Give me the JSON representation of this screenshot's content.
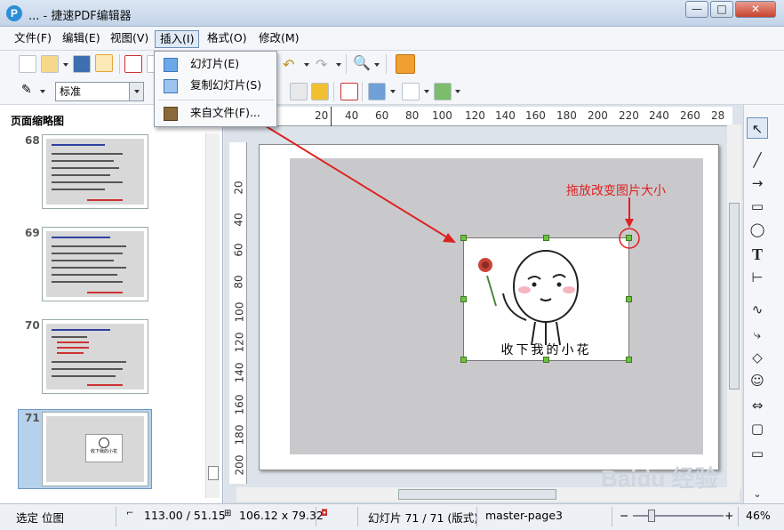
{
  "window": {
    "title": "  ...  - 捷速PDF编辑器",
    "buttons": [
      "—",
      "□",
      "✕"
    ]
  },
  "menu": [
    {
      "label": "文件(F)"
    },
    {
      "label": "编辑(E)"
    },
    {
      "label": "视图(V)"
    },
    {
      "label": "插入(I)"
    },
    {
      "label": "格式(O)"
    },
    {
      "label": "修改(M)"
    }
  ],
  "insert_menu": {
    "items": [
      {
        "label": "幻灯片(E)",
        "icon": "slide-icon"
      },
      {
        "label": "复制幻灯片(S)",
        "icon": "duplicate-slide-icon"
      },
      {
        "label": "来自文件(F)...",
        "icon": "image-file-icon"
      }
    ]
  },
  "toolbar": {
    "style_select": "标准"
  },
  "left_panel": {
    "title": "页面缩略图",
    "thumbnails": [
      {
        "number": "68"
      },
      {
        "number": "69"
      },
      {
        "number": "70"
      },
      {
        "number": "71"
      }
    ],
    "thumb_71_caption": "收下我的小花"
  },
  "ruler": {
    "horizontal": [
      "20",
      "40",
      "60",
      "80",
      "100",
      "120",
      "140",
      "160",
      "180",
      "200",
      "220",
      "240",
      "260",
      "28"
    ],
    "vertical": [
      "20",
      "40",
      "60",
      "80",
      "100",
      "120",
      "140",
      "160",
      "180",
      "200"
    ]
  },
  "canvas": {
    "image_caption": "收下我的小花",
    "annotation": "拖放改变图片大小"
  },
  "status": {
    "selection": "选定 位图",
    "position": "113.00 / 51.15",
    "size": "106.12 x 79.32",
    "slide": "幻灯片 71 / 71 (版式)",
    "master": "master-page3",
    "zoom": "46%"
  },
  "colors": {
    "annotation_red": "#dd2222",
    "handle_green": "#70c040",
    "selected_thumb": "#b7d1ec"
  },
  "watermark": "Baidu 经验"
}
